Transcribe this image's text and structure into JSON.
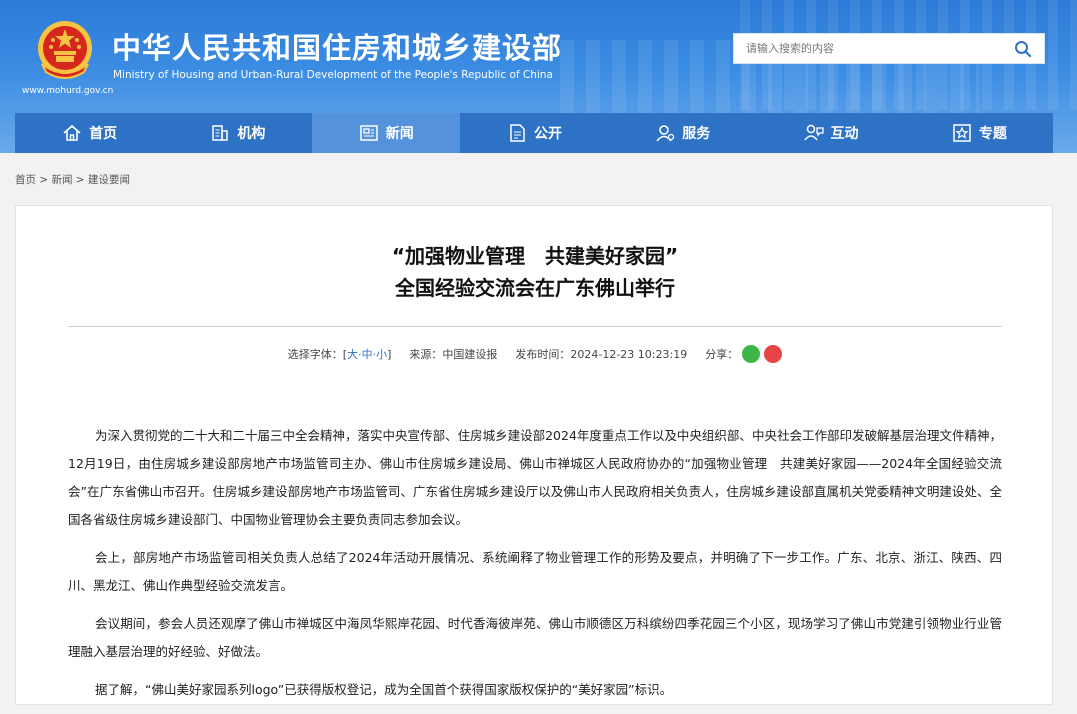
{
  "header": {
    "site_url": "www.mohurd.gov.cn",
    "title_cn": "中华人民共和国住房和城乡建设部",
    "title_en": "Ministry of Housing and Urban-Rural Development of the People's Republic of China",
    "search_placeholder": "请输入搜索的内容"
  },
  "nav": [
    {
      "label": "首页",
      "icon": "home-icon"
    },
    {
      "label": "机构",
      "icon": "building-icon"
    },
    {
      "label": "新闻",
      "icon": "news-icon",
      "active": true
    },
    {
      "label": "公开",
      "icon": "document-icon"
    },
    {
      "label": "服务",
      "icon": "user-service-icon"
    },
    {
      "label": "互动",
      "icon": "interaction-icon"
    },
    {
      "label": "专题",
      "icon": "star-icon"
    }
  ],
  "breadcrumb": "首页 > 新闻 > 建设要闻",
  "article": {
    "title_line1": "“加强物业管理　共建美好家园”",
    "title_line2": "全国经验交流会在广东佛山举行",
    "font_label": "选择字体：[",
    "font_large": "大",
    "font_medium": "中",
    "font_small": "小",
    "font_end": "]",
    "source": "来源：中国建设报",
    "publish_time": "发布时间：2024-12-23 10:23:19",
    "share_label": "分享：",
    "paragraphs": [
      "为深入贯彻党的二十大和二十届三中全会精神，落实中央宣传部、住房城乡建设部2024年度重点工作以及中央组织部、中央社会工作部印发破解基层治理文件精神，12月19日，由住房城乡建设部房地产市场监管司主办、佛山市住房城乡建设局、佛山市禅城区人民政府协办的“加强物业管理　共建美好家园——2024年全国经验交流会”在广东省佛山市召开。住房城乡建设部房地产市场监管司、广东省住房城乡建设厅以及佛山市人民政府相关负责人，住房城乡建设部直属机关党委精神文明建设处、全国各省级住房城乡建设部门、中国物业管理协会主要负责同志参加会议。",
      "会上，部房地产市场监管司相关负责人总结了2024年活动开展情况、系统阐释了物业管理工作的形势及要点，并明确了下一步工作。广东、北京、浙江、陕西、四川、黑龙江、佛山作典型经验交流发言。",
      "会议期间，参会人员还观摩了佛山市禅城区中海凤华熙岸花园、时代香海彼岸苑、佛山市顺德区万科缤纷四季花园三个小区，现场学习了佛山市党建引领物业行业管理融入基层治理的好经验、好做法。",
      "据了解，“佛山美好家园系列logo”已获得版权登记，成为全国首个获得国家版权保护的“美好家园”标识。"
    ]
  }
}
